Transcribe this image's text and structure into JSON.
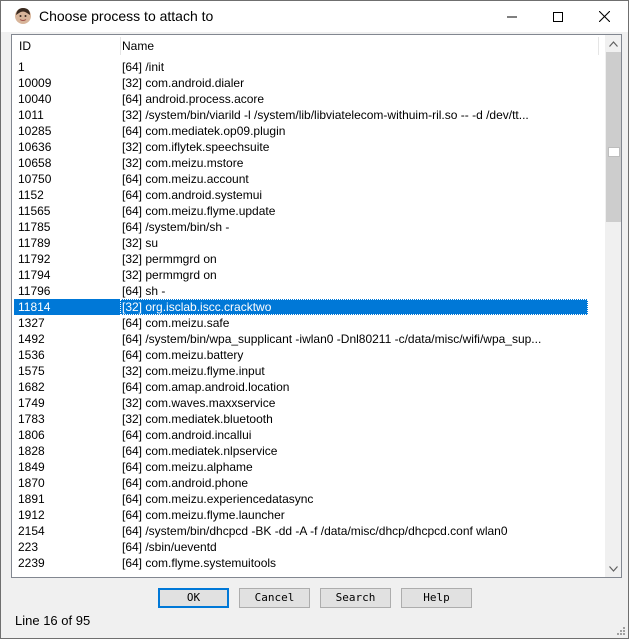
{
  "window": {
    "title": "Choose process to attach to",
    "minimize_icon": "minimize-icon",
    "maximize_icon": "maximize-icon",
    "close_icon": "close-icon"
  },
  "list": {
    "columns": [
      "ID",
      "Name"
    ],
    "selected_index": 15,
    "rows": [
      {
        "id": "1",
        "name": "[64] /init"
      },
      {
        "id": "10009",
        "name": "[32] com.android.dialer"
      },
      {
        "id": "10040",
        "name": "[64] android.process.acore"
      },
      {
        "id": "1011",
        "name": "[32] /system/bin/viarild -l /system/lib/libviatelecom-withuim-ril.so -- -d /dev/tt..."
      },
      {
        "id": "10285",
        "name": "[64] com.mediatek.op09.plugin"
      },
      {
        "id": "10636",
        "name": "[32] com.iflytek.speechsuite"
      },
      {
        "id": "10658",
        "name": "[32] com.meizu.mstore"
      },
      {
        "id": "10750",
        "name": "[64] com.meizu.account"
      },
      {
        "id": "1152",
        "name": "[64] com.android.systemui"
      },
      {
        "id": "11565",
        "name": "[64] com.meizu.flyme.update"
      },
      {
        "id": "11785",
        "name": "[64] /system/bin/sh -"
      },
      {
        "id": "11789",
        "name": "[32] su"
      },
      {
        "id": "11792",
        "name": "[32] permmgrd on"
      },
      {
        "id": "11794",
        "name": "[32] permmgrd on"
      },
      {
        "id": "11796",
        "name": "[64] sh -"
      },
      {
        "id": "11814",
        "name": "[32] org.isclab.iscc.cracktwo"
      },
      {
        "id": "1327",
        "name": "[64] com.meizu.safe"
      },
      {
        "id": "1492",
        "name": "[64] /system/bin/wpa_supplicant -iwlan0 -Dnl80211 -c/data/misc/wifi/wpa_sup..."
      },
      {
        "id": "1536",
        "name": "[64] com.meizu.battery"
      },
      {
        "id": "1575",
        "name": "[32] com.meizu.flyme.input"
      },
      {
        "id": "1682",
        "name": "[64] com.amap.android.location"
      },
      {
        "id": "1749",
        "name": "[32] com.waves.maxxservice"
      },
      {
        "id": "1783",
        "name": "[32] com.mediatek.bluetooth"
      },
      {
        "id": "1806",
        "name": "[64] com.android.incallui"
      },
      {
        "id": "1828",
        "name": "[64] com.mediatek.nlpservice"
      },
      {
        "id": "1849",
        "name": "[64] com.meizu.alphame"
      },
      {
        "id": "1870",
        "name": "[64] com.android.phone"
      },
      {
        "id": "1891",
        "name": "[64] com.meizu.experiencedatasync"
      },
      {
        "id": "1912",
        "name": "[64] com.meizu.flyme.launcher"
      },
      {
        "id": "2154",
        "name": "[64] /system/bin/dhcpcd -BK -dd -A -f /data/misc/dhcp/dhcpcd.conf wlan0"
      },
      {
        "id": "223",
        "name": "[64] /sbin/ueventd"
      },
      {
        "id": "2239",
        "name": "[64] com.flyme.systemuitools"
      }
    ]
  },
  "buttons": {
    "ok": "OK",
    "cancel": "Cancel",
    "search": "Search",
    "help": "Help"
  },
  "status": {
    "text": "Line 16 of 95"
  },
  "colors": {
    "selection": "#0078d7",
    "default_button_border": "#0078d7"
  }
}
